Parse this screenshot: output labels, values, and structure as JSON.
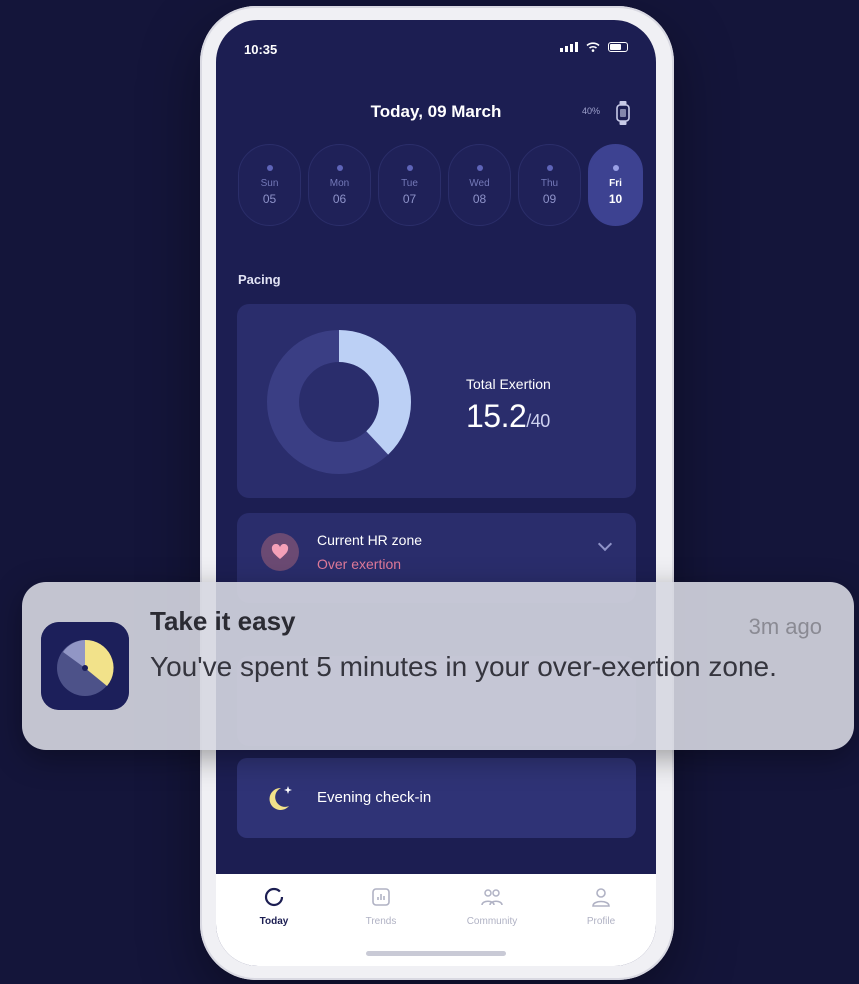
{
  "status_bar": {
    "time": "10:35"
  },
  "header": {
    "date": "Today, 09 March",
    "watch_battery": "40%"
  },
  "days": [
    {
      "name": "Sun",
      "num": "05",
      "active": false
    },
    {
      "name": "Mon",
      "num": "06",
      "active": false
    },
    {
      "name": "Tue",
      "num": "07",
      "active": false
    },
    {
      "name": "Wed",
      "num": "08",
      "active": false
    },
    {
      "name": "Thu",
      "num": "09",
      "active": false
    },
    {
      "name": "Fri",
      "num": "10",
      "active": true
    }
  ],
  "pacing": {
    "section_label": "Pacing",
    "exertion_label": "Total Exertion",
    "exertion_value": "15.2",
    "exertion_max": "/40",
    "exertion_fraction": 0.38
  },
  "hr_zone": {
    "title": "Current HR zone",
    "value": "Over exertion"
  },
  "checkin": {
    "label": "Evening check-in"
  },
  "tabs": [
    {
      "label": "Today",
      "icon": "today-ring-icon",
      "active": true
    },
    {
      "label": "Trends",
      "icon": "trends-chart-icon",
      "active": false
    },
    {
      "label": "Community",
      "icon": "community-icon",
      "active": false
    },
    {
      "label": "Profile",
      "icon": "profile-icon",
      "active": false
    }
  ],
  "notification": {
    "title": "Take it easy",
    "time": "3m ago",
    "body": "You've spent 5 minutes in your over-exertion zone."
  },
  "colors": {
    "background": "#14153a",
    "screen": "#1c1e52",
    "card": "#2a2d6c",
    "donut_track": "#3a3e84",
    "donut_fill": "#bcd0f5",
    "over_exertion": "#e07a9a",
    "moon": "#f2e28a"
  }
}
